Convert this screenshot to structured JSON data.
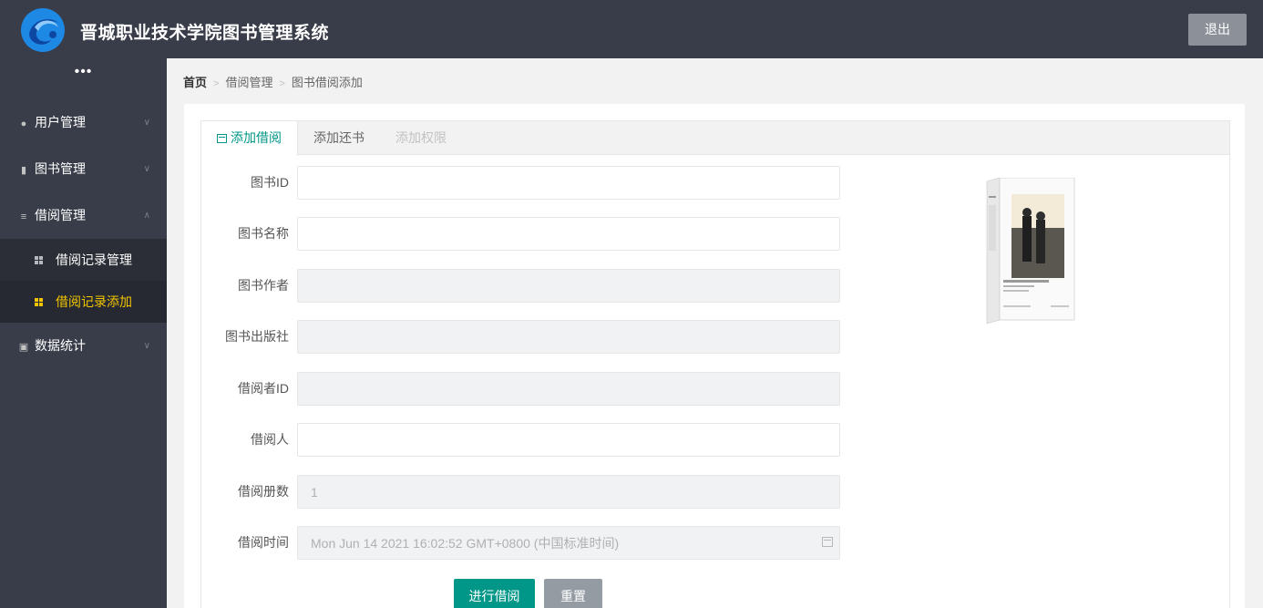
{
  "header": {
    "title": "晋城职业技术学院图书管理系统",
    "logout_label": "退出"
  },
  "sidebar": {
    "more": "•••",
    "items": [
      {
        "label": "用户管理",
        "icon": "user-icon"
      },
      {
        "label": "图书管理",
        "icon": "bar-chart-icon"
      },
      {
        "label": "借阅管理",
        "icon": "menu-icon"
      },
      {
        "label": "数据统计",
        "icon": "stats-icon"
      }
    ],
    "sub_items": [
      {
        "label": "借阅记录管理"
      },
      {
        "label": "借阅记录添加",
        "active": true
      }
    ]
  },
  "breadcrumb": {
    "home": "首页",
    "level1": "借阅管理",
    "level2": "图书借阅添加"
  },
  "tabs": [
    {
      "label": "添加借阅",
      "state": "active"
    },
    {
      "label": "添加还书",
      "state": "normal"
    },
    {
      "label": "添加权限",
      "state": "disabled"
    }
  ],
  "form": {
    "book_id": {
      "label": "图书ID",
      "value": ""
    },
    "book_name": {
      "label": "图书名称",
      "value": ""
    },
    "book_author": {
      "label": "图书作者",
      "value": ""
    },
    "book_publisher": {
      "label": "图书出版社",
      "value": ""
    },
    "borrower_id": {
      "label": "借阅者ID",
      "value": ""
    },
    "borrower": {
      "label": "借阅人",
      "value": ""
    },
    "borrow_count": {
      "label": "借阅册数",
      "value": "1"
    },
    "borrow_time": {
      "label": "借阅时间",
      "value": "Mon Jun 14 2021 16:02:52 GMT+0800 (中国标准时间)"
    }
  },
  "buttons": {
    "submit": "进行借阅",
    "reset": "重置"
  },
  "colors": {
    "header_bg": "#393d49",
    "accent": "#009688",
    "active_nav": "#f2c500"
  }
}
